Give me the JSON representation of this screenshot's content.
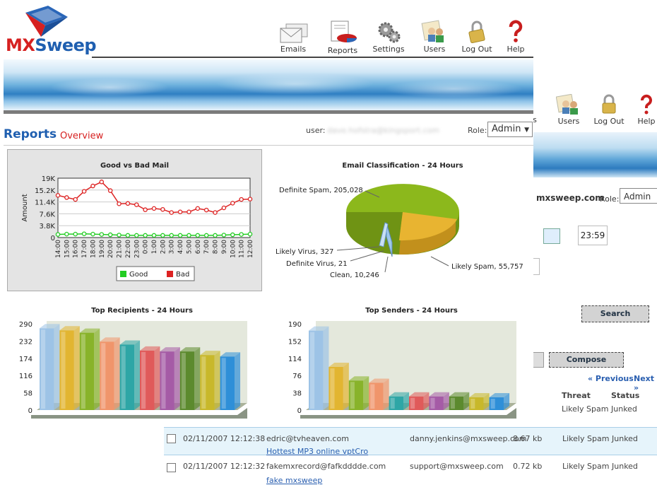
{
  "app": {
    "logo_mx": "MX",
    "logo_sweep": "Sweep"
  },
  "nav": [
    {
      "label": "Emails",
      "icon": "envelope-icon"
    },
    {
      "label": "Reports",
      "icon": "reports-icon"
    },
    {
      "label": "Settings",
      "icon": "gear-icon"
    },
    {
      "label": "Users",
      "icon": "users-icon"
    },
    {
      "label": "Log Out",
      "icon": "lock-icon"
    },
    {
      "label": "Help",
      "icon": "help-icon"
    }
  ],
  "page": {
    "title": "Reports",
    "subtitle": "Overview",
    "user_label": "user:",
    "user_value": "dave.hofstra@kingsport.com",
    "role_label": "Role:",
    "role_value": "Admin"
  },
  "background_window": {
    "nav": [
      {
        "label": "s",
        "icon": "partial-icon"
      },
      {
        "label": "Users",
        "icon": "users-icon"
      },
      {
        "label": "Log Out",
        "icon": "lock-icon"
      },
      {
        "label": "Help",
        "icon": "help-icon"
      }
    ],
    "user_value": "mxsweep.com",
    "role_label": "Role:",
    "role_value": "Admin",
    "time_value": "23:59",
    "search_label": "Search",
    "compose_label": "Compose",
    "previous_label": "« Previous",
    "next_label": "Next »",
    "table_headers": {
      "threat": "Threat",
      "status": "Status"
    },
    "first_row": {
      "threat": "Likely Spam",
      "status": "Junked"
    }
  },
  "messages": [
    {
      "date": "02/11/2007 12:12:38",
      "from": "edric@tvheaven.com",
      "to": "danny.jenkins@mxsweep.com",
      "size": "8.67 kb",
      "threat": "Likely Spam",
      "status": "Junked",
      "subject": "Hottest MP3 online vptCro"
    },
    {
      "date": "02/11/2007 12:12:32",
      "from": "fakemxrecord@fafkdddde.com",
      "to": "support@mxsweep.com",
      "size": "0.72 kb",
      "threat": "Likely Spam",
      "status": "Junked",
      "subject": "fake mxsweep"
    }
  ],
  "chart_data": [
    {
      "type": "line",
      "title": "Good vs Bad Mail",
      "ylabel": "Amount",
      "xlabel": "",
      "ylim": [
        0,
        19000
      ],
      "y_ticks": [
        "0",
        "3.8K",
        "7.6K",
        "11.4K",
        "15.2K",
        "19K"
      ],
      "categories": [
        "14:00",
        "15:00",
        "16:00",
        "17:00",
        "18:00",
        "19:00",
        "20:00",
        "21:00",
        "22:00",
        "23:00",
        "0:00",
        "1:00",
        "2:00",
        "3:00",
        "4:00",
        "5:00",
        "6:00",
        "7:00",
        "8:00",
        "9:00",
        "10:00",
        "11:00",
        "12:00"
      ],
      "series": [
        {
          "name": "Good",
          "color": "#22cc22",
          "values": [
            1000,
            1100,
            1100,
            1200,
            1100,
            1000,
            900,
            800,
            700,
            700,
            700,
            700,
            700,
            700,
            700,
            700,
            700,
            700,
            700,
            800,
            900,
            1000,
            1100
          ]
        },
        {
          "name": "Bad",
          "color": "#dd2222",
          "values": [
            13500,
            12800,
            12200,
            14800,
            16500,
            17800,
            15000,
            10800,
            10900,
            10500,
            8900,
            9300,
            9000,
            8000,
            8200,
            8200,
            9300,
            8800,
            8000,
            9500,
            11000,
            12200,
            12300
          ]
        }
      ],
      "legend": "bottom"
    },
    {
      "type": "pie",
      "title": "Email Classification - 24 Hours",
      "labels": [
        "Definite Spam",
        "Likely Spam",
        "Clean",
        "Definite Virus",
        "Likely Virus"
      ],
      "values": [
        205028,
        55757,
        10246,
        21,
        327
      ],
      "colors": [
        "#8cb81c",
        "#e8b431",
        "#9ec8ea",
        "#c2c2c2",
        "#6fa3d2"
      ],
      "annotations": [
        "Definite Spam, 205,028",
        "Likely Spam, 55,757",
        "Clean, 10,246",
        "Definite Virus, 21",
        "Likely Virus, 327"
      ]
    },
    {
      "type": "bar",
      "title": "Top Recipients - 24 Hours",
      "ylim": [
        0,
        290
      ],
      "y_ticks": [
        "0",
        "58",
        "116",
        "174",
        "232",
        "290"
      ],
      "values": [
        275,
        268,
        260,
        230,
        220,
        200,
        197,
        197,
        185,
        180
      ],
      "colors": [
        "#9dc3e6",
        "#e2b531",
        "#88b32a",
        "#f0956b",
        "#2ea6a6",
        "#e05a5a",
        "#a55ba6",
        "#5c8a2e",
        "#c8b82a",
        "#2e8fd8"
      ]
    },
    {
      "type": "bar",
      "title": "Top Senders - 24 Hours",
      "ylim": [
        0,
        190
      ],
      "y_ticks": [
        "0",
        "38",
        "76",
        "114",
        "152",
        "190"
      ],
      "values": [
        175,
        95,
        65,
        60,
        30,
        30,
        30,
        30,
        28,
        28
      ],
      "colors": [
        "#9dc3e6",
        "#e2b531",
        "#88b32a",
        "#f0956b",
        "#2ea6a6",
        "#e05a5a",
        "#a55ba6",
        "#5c8a2e",
        "#c8b82a",
        "#2e8fd8"
      ]
    }
  ]
}
